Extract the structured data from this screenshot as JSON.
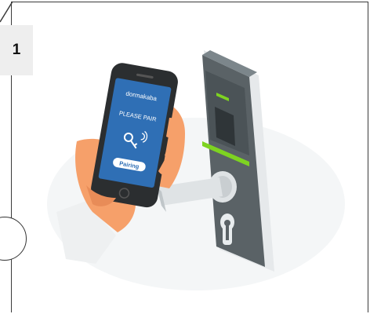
{
  "step": {
    "number": "1"
  },
  "phone": {
    "brand": "dormakaba",
    "message": "PLEASE PAIR",
    "button_label": "Pairing"
  },
  "colors": {
    "phone_screen": "#2f6fb5",
    "lock_body": "#5a6266",
    "lock_plate": "#dfe3e5",
    "indicator_green": "#7ed321",
    "hand_skin": "#f6a06a"
  }
}
